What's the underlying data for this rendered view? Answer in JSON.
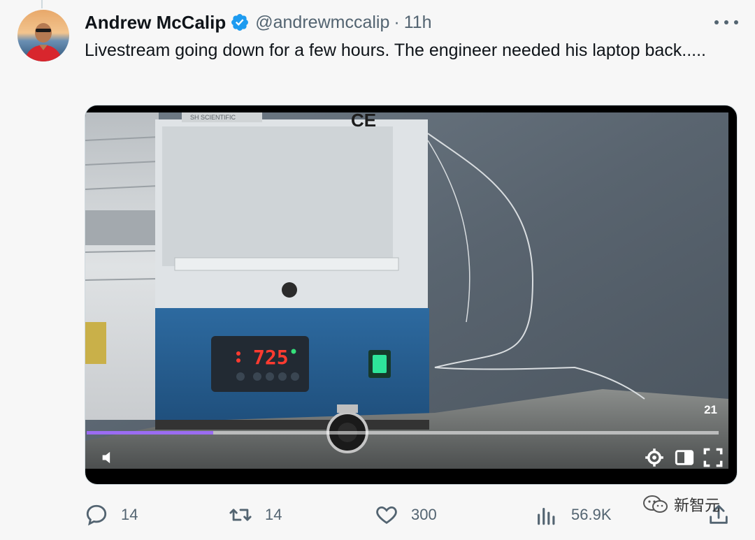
{
  "tweet": {
    "author": {
      "display_name": "Andrew McCalip",
      "handle": "@andrewmccalip",
      "verified": true
    },
    "separator": "·",
    "time": "11h",
    "text": "Livestream going down for a few hours. The engineer needed his laptop back.....",
    "media": {
      "type": "video",
      "timestamp_badge": "21",
      "progress_fraction": 0.2,
      "progress_color": "#9b6cf2",
      "frame": {
        "furnace_brand": "SH SCIENTIFIC",
        "ce_mark": "CE",
        "temperature_display": "725"
      }
    },
    "actions": {
      "reply_count": "14",
      "retweet_count": "14",
      "like_count": "300",
      "views_count": "56.9K"
    }
  },
  "watermark": {
    "text": "新智元"
  },
  "colors": {
    "verified_blue": "#1d9bf0",
    "secondary_text": "#536471",
    "background": "#f7f7f7"
  },
  "icons": [
    "verified-badge-icon",
    "more-icon",
    "volume-icon",
    "settings-icon",
    "pip-icon",
    "fullscreen-icon",
    "reply-icon",
    "retweet-icon",
    "like-icon",
    "views-icon",
    "share-icon"
  ]
}
